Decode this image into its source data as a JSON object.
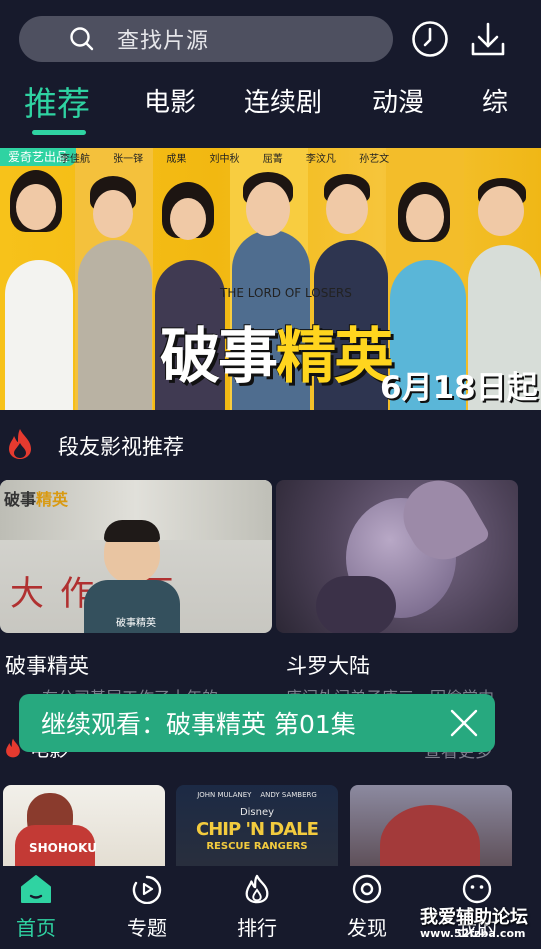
{
  "header": {
    "search_placeholder": "查找片源",
    "icons": [
      "search-icon",
      "history-clock-icon",
      "download-icon"
    ]
  },
  "tabs": [
    {
      "label": "推荐",
      "active": true
    },
    {
      "label": "电影",
      "active": false
    },
    {
      "label": "连续剧",
      "active": false
    },
    {
      "label": "动漫",
      "active": false
    },
    {
      "label": "综",
      "active": false
    }
  ],
  "banner": {
    "tag": "爱奇艺出品",
    "cast": "李佳航 张一铎 成果 刘中秋 屈菁 李汶凡 孙艺文",
    "subtitle": "THE LORD OF LOSERS",
    "title_part1": "破事",
    "title_part2": "精英",
    "date": "6月18日起"
  },
  "recommend_section": {
    "title": "段友影视推荐",
    "icon": "flame-icon",
    "cards": [
      {
        "title": "破事精英",
        "desc": "在公司基层工作了十年的...",
        "poster_caption": "破事精英"
      },
      {
        "title": "斗罗大陆",
        "desc": "唐门外门弟子唐三，因偷学内"
      }
    ]
  },
  "continue_watch": {
    "text": "继续观看：破事精英  第01集",
    "close_icon": "close-icon"
  },
  "movie_section": {
    "title": "电影",
    "more": "查看更多",
    "icon": "flame-icon",
    "posters": [
      {
        "caption": ""
      },
      {
        "caption": "CHIP 'N DALE",
        "caption2": "RESCUE RANGERS",
        "top": "JOHN MULANEY    ANDY SAMBERG"
      },
      {
        "caption": ""
      }
    ]
  },
  "bottom_nav": [
    {
      "label": "首页",
      "icon": "home-icon",
      "active": true
    },
    {
      "label": "专题",
      "icon": "topic-play-icon",
      "active": false
    },
    {
      "label": "排行",
      "icon": "rank-flame-icon",
      "active": false
    },
    {
      "label": "发现",
      "icon": "discover-icon",
      "active": false
    },
    {
      "label": "我的",
      "icon": "profile-icon",
      "active": false
    }
  ],
  "watermark": {
    "line1": "我爱辅助论坛",
    "line2": "www.52fzba.com"
  },
  "colors": {
    "accent": "#2fd3a2",
    "background": "#171a2c",
    "toast": "#27a97f",
    "search_bg": "#4e5060"
  }
}
